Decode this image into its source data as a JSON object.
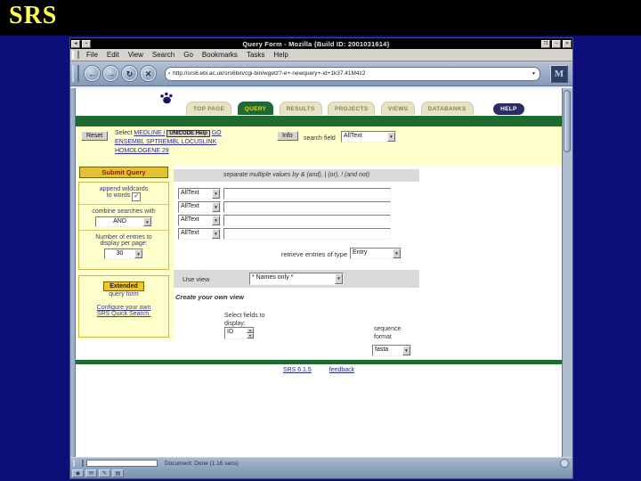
{
  "slide": {
    "title": "SRS"
  },
  "colors": {
    "slide_bg": "#0e0e78",
    "band_bg": "#000000",
    "title_yellow": "#ffff4d",
    "srs_green": "#1f6b2f",
    "form_yellow": "#ffffcc",
    "tab_cream": "#e6e2c4",
    "active_tab_text": "#ffd400",
    "help_navy": "#2b2b66",
    "gold": "#f0c818",
    "link_blue": "#2a2a8f",
    "chrome_blue": "#9fb0c6"
  },
  "icons": {
    "back": "←",
    "forward": "→",
    "reload": "↻",
    "stop": "✕",
    "dropdown": "▼",
    "spin_up": "▲",
    "spin_down": "▼",
    "check": "✓",
    "window_left1": "◄",
    "window_left2": "▪",
    "restore": "❐",
    "minimize": "─",
    "close": "✕",
    "bookmark": "▪",
    "throbber": "M",
    "navigator": "◉",
    "mail": "✉",
    "compose": "✎",
    "addressbook": "▤"
  },
  "browser": {
    "title": "Query Form - Mozilla {Build ID: 2001031614}",
    "menu": {
      "file": "File",
      "edit": "Edit",
      "view": "View",
      "search": "Search",
      "go": "Go",
      "bookmarks": "Bookmarks",
      "tasks": "Tasks",
      "help": "Help"
    },
    "url": "http://srs6.ebi.ac.uk/srs6bin/cgi-bin/wgetz?-e+-newquery+-id+1k37.41M4z2",
    "status": "Document: Done (1.16 secs)"
  },
  "nav_tabs": {
    "top_page": "TOP PAGE",
    "query": "QUERY",
    "results": "RESULTS",
    "projects": "PROJECTS",
    "views": "VIEWS",
    "databanks": "DATABANKS",
    "help": "HELP"
  },
  "selector": {
    "reset": "Reset",
    "select_prefix": "Select",
    "medline": "MEDLINE /",
    "unicode_help": "UNICODE Help",
    "go": "GO",
    "line2": "ENSEMBL SPTREMBL LOCUSLINK",
    "line3": "HOMOLOGENE 29",
    "info": "Info",
    "field_label": "search field",
    "field_value": "AllText"
  },
  "sidebar": {
    "submit": "Submit Query",
    "wildcards_1": "append wildcards",
    "wildcards_2": "to words",
    "combine": "combine searches with",
    "combine_value": "AND",
    "per_page_1": "Number of entries to",
    "per_page_2": "display per page:",
    "per_page_value": "30",
    "extended": "Extended",
    "extended_suffix": "query form",
    "quick1": "Configure your own",
    "quick2": "SRS Quick Search."
  },
  "form": {
    "note": "separate multiple values by & (and), | (or), ! (and not)",
    "field_value": "AllText",
    "retrieve": "retrieve entries of type",
    "retrieve_value": "Entry",
    "use_view": "Use view",
    "use_view_value": "* Names only *",
    "create_view": "Create your own view",
    "fields1": "Select fields to",
    "fields2": "display:",
    "fields_value": "ID",
    "format1": "sequence",
    "format2": "format",
    "format_value": "fasta"
  },
  "footer": {
    "version": "SRS 6.1.5",
    "feedback": "feedback"
  }
}
